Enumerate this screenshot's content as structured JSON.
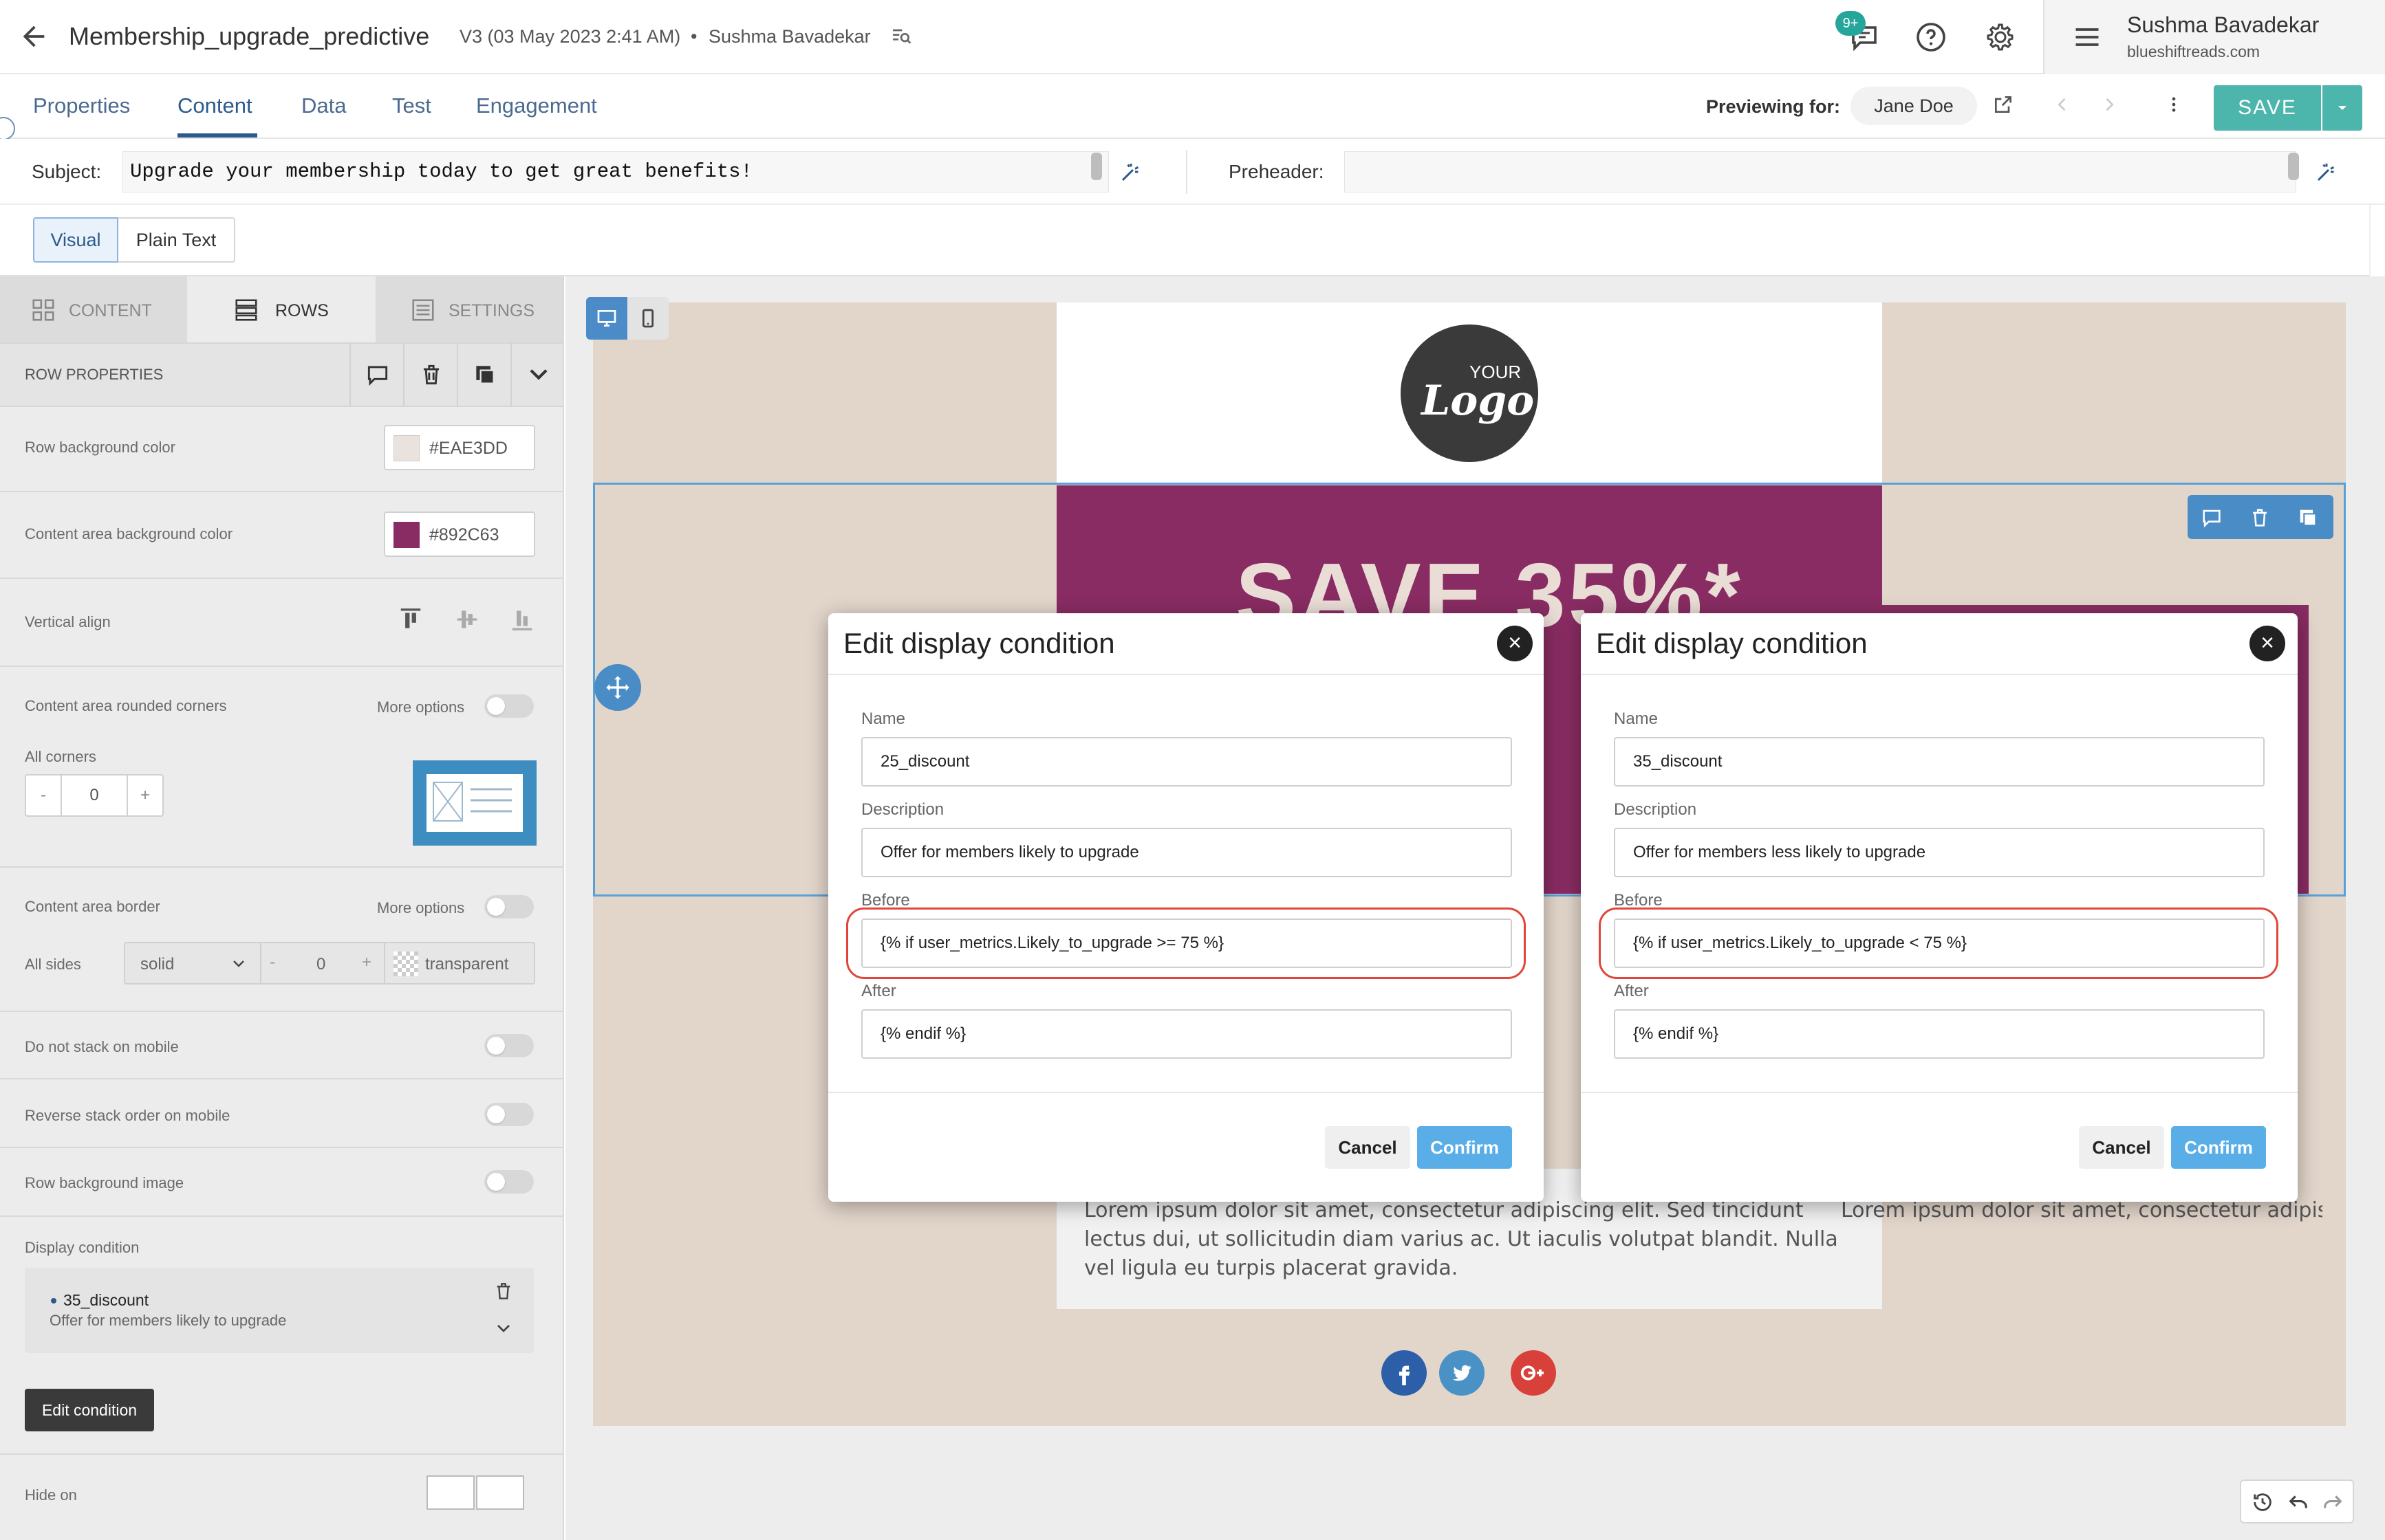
{
  "header": {
    "title": "Membership_upgrade_predictive",
    "version": "V3 (03 May 2023 2:41 AM)",
    "bullet": "•",
    "author": "Sushma Bavadekar",
    "notif_badge": "9+",
    "user_name": "Sushma Bavadekar",
    "user_domain": "blueshiftreads.com"
  },
  "tabs": [
    {
      "label": "Properties"
    },
    {
      "label": "Content"
    },
    {
      "label": "Data"
    },
    {
      "label": "Test"
    },
    {
      "label": "Engagement"
    }
  ],
  "preview": {
    "label": "Previewing for:",
    "user": "Jane Doe",
    "save_label": "SAVE"
  },
  "subject": {
    "label": "Subject:",
    "value": "Upgrade your membership today to get great benefits!",
    "preheader_label": "Preheader:",
    "preheader_value": ""
  },
  "modes": {
    "visual": "Visual",
    "plain": "Plain Text"
  },
  "left_panel": {
    "tabs": [
      {
        "label": "CONTENT"
      },
      {
        "label": "ROWS"
      },
      {
        "label": "SETTINGS"
      }
    ],
    "section_title": "ROW PROPERTIES",
    "row_bg_label": "Row background color",
    "row_bg_value": "#EAE3DD",
    "content_bg_label": "Content area background color",
    "content_bg_value": "#892C63",
    "valign_label": "Vertical align",
    "rounded_label": "Content area rounded corners",
    "more_options": "More options",
    "all_corners": "All corners",
    "corner_minus": "-",
    "corner_value": "0",
    "corner_plus": "+",
    "border_label": "Content area border",
    "all_sides": "All sides",
    "border_style": "solid",
    "border_width": "0",
    "border_color": "transparent",
    "stack_label": "Do not stack on mobile",
    "reverse_label": "Reverse stack order on mobile",
    "bgimage_label": "Row background image",
    "display_condition_label": "Display condition",
    "condition_name": "35_discount",
    "condition_desc": "Offer for members likely to upgrade",
    "edit_condition": "Edit condition",
    "hide_on": "Hide on"
  },
  "colors": {
    "accent": "#2c5a8c",
    "save": "#4db6ac",
    "swatch_row": "#EAE3DD",
    "swatch_content": "#892C63",
    "banner": "#892C63",
    "highlight": "#e0463c",
    "confirm": "#5aaee8"
  },
  "email": {
    "logo_small": "YOUR",
    "logo_big": "Logo",
    "banner_headline": "SAVE 35%*",
    "lorem_left": "Lorem ipsum dolor sit amet, consectetur adipiscing elit. Sed tincidunt lectus dui, ut sollicitudin diam varius ac. Ut iaculis volutpat blandit. Nulla vel ligula eu turpis placerat gravida.",
    "lorem_right": "Lorem ipsum dolor sit amet, consectetur adipiscin"
  },
  "dialog_left": {
    "title": "Edit display condition",
    "name_label": "Name",
    "name_value": "25_discount",
    "desc_label": "Description",
    "desc_value": "Offer for members likely to upgrade",
    "before_label": "Before",
    "before_value": "{% if user_metrics.Likely_to_upgrade >= 75 %}",
    "after_label": "After",
    "after_value": "{% endif %}",
    "cancel": "Cancel",
    "confirm": "Confirm"
  },
  "dialog_right": {
    "title": "Edit display condition",
    "name_label": "Name",
    "name_value": "35_discount",
    "desc_label": "Description",
    "desc_value": "Offer for members less likely to upgrade",
    "before_label": "Before",
    "before_value": "{% if user_metrics.Likely_to_upgrade < 75 %}",
    "after_label": "After",
    "after_value": "{% endif %}",
    "cancel": "Cancel",
    "confirm": "Confirm"
  }
}
